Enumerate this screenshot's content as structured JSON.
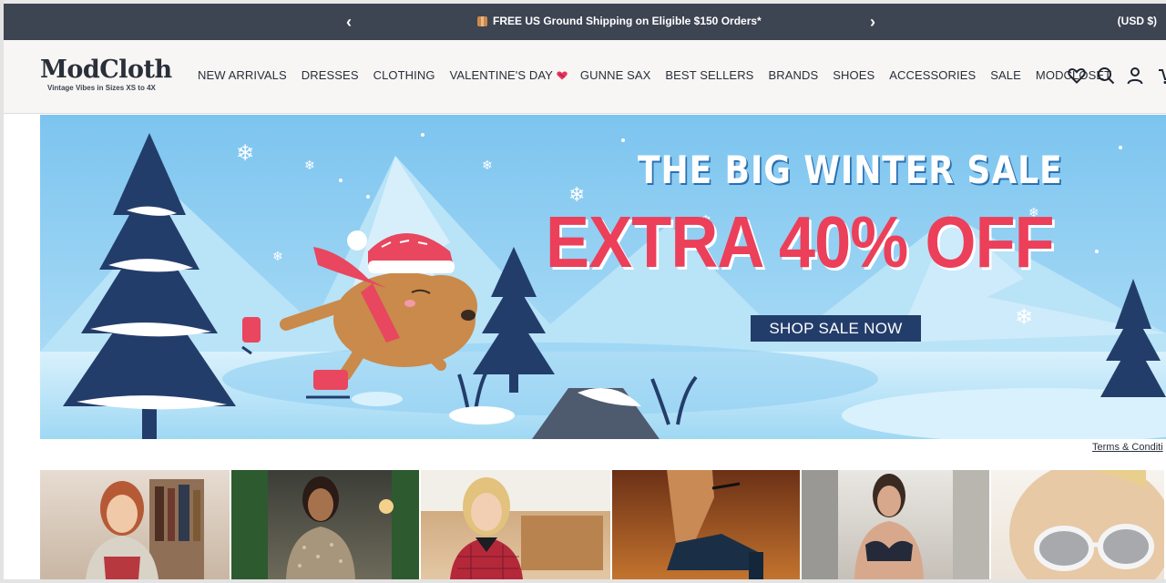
{
  "promo": {
    "prev_arrow": "‹",
    "next_arrow": "›",
    "message": "FREE US Ground Shipping on Eligible $150 Orders*",
    "currency": "(USD $)"
  },
  "header": {
    "logo_wordmark": "ModCloth",
    "logo_tagline": "Vintage Vibes in Sizes XS to 4X",
    "nav": [
      {
        "label": "NEW ARRIVALS"
      },
      {
        "label": "DRESSES"
      },
      {
        "label": "CLOTHING"
      },
      {
        "label": "VALENTINE'S DAY"
      },
      {
        "label": "GUNNE SAX"
      },
      {
        "label": "BEST SELLERS"
      },
      {
        "label": "BRANDS"
      },
      {
        "label": "SHOES"
      },
      {
        "label": "ACCESSORIES"
      },
      {
        "label": "SALE"
      },
      {
        "label": "MODCLOSET"
      }
    ],
    "icons": [
      "heart-icon",
      "search-icon",
      "user-icon",
      "cart-icon"
    ]
  },
  "hero": {
    "headline": "THE BIG WINTER SALE",
    "offer": "EXTRA 40% OFF",
    "cta": "SHOP SALE NOW",
    "colors": {
      "offer": "#ec3f5a",
      "cta_bg": "#233d6b",
      "sky": "#8fd0f3"
    }
  },
  "terms": "Terms & Conditi",
  "tiles": [
    {
      "name": "tile-cardigans"
    },
    {
      "name": "tile-sequin-top"
    },
    {
      "name": "tile-plaid-dress"
    },
    {
      "name": "tile-heels"
    },
    {
      "name": "tile-lingerie"
    },
    {
      "name": "tile-sunglasses"
    }
  ]
}
